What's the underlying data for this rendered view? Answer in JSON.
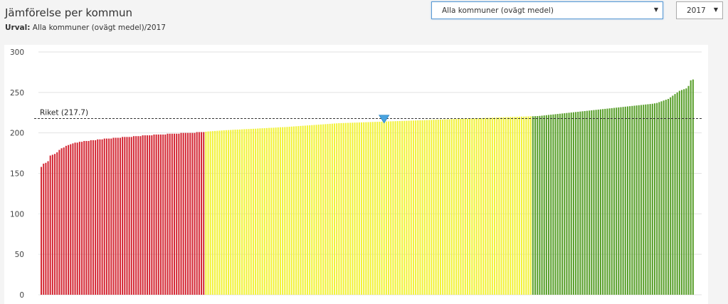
{
  "header": {
    "title": "Jämförelse per kommun",
    "subtitle_label": "Urval:",
    "subtitle_value": "Alla kommuner (ovägt medel)/2017"
  },
  "controls": {
    "municipality_select": "Alla kommuner (ovägt medel)",
    "year_select": "2017"
  },
  "colors": {
    "low": "#d42a36",
    "mid": "#f2f23a",
    "high": "#5aa02c",
    "marker": "#4aa3df",
    "grid": "#e2e2e2",
    "reference": "#333333"
  },
  "chart_data": {
    "type": "bar",
    "ylim": [
      0,
      300
    ],
    "yticks": [
      0,
      50,
      100,
      150,
      200,
      250,
      300
    ],
    "grid": true,
    "reference_line": {
      "label": "Riket (217.7)",
      "value": 217.7
    },
    "bar_count": 290,
    "segments": [
      {
        "color": "low",
        "count": 73
      },
      {
        "color": "mid",
        "count": 145
      },
      {
        "color": "high",
        "count": 72
      }
    ],
    "highlight_index": 152,
    "values": [
      158,
      162,
      163,
      165,
      172,
      173,
      174,
      176,
      179,
      181,
      182,
      184,
      185,
      186,
      187,
      188,
      188,
      189,
      189,
      190,
      190,
      190,
      191,
      191,
      191,
      192,
      192,
      192,
      193,
      193,
      193,
      193,
      194,
      194,
      194,
      194,
      195,
      195,
      195,
      195,
      195,
      196,
      196,
      196,
      196,
      197,
      197,
      197,
      197,
      197,
      198,
      198,
      198,
      198,
      198,
      198,
      199,
      199,
      199,
      199,
      199,
      199,
      200,
      200,
      200,
      200,
      200,
      200,
      200,
      201,
      201,
      201,
      201,
      201.5,
      201.8,
      202,
      202.2,
      202.4,
      202.6,
      202.8,
      203,
      203.2,
      203.4,
      203.5,
      203.6,
      203.8,
      204,
      204.1,
      204.2,
      204.4,
      204.6,
      204.7,
      204.8,
      205,
      205.1,
      205.2,
      205.4,
      205.6,
      205.7,
      205.8,
      206,
      206.2,
      206.3,
      206.4,
      206.6,
      206.8,
      207,
      207.1,
      207.2,
      207.4,
      207.6,
      207.8,
      208,
      208.2,
      208.4,
      208.6,
      208.8,
      209,
      209.2,
      209.4,
      209.6,
      209.8,
      210,
      210.2,
      210.4,
      210.6,
      210.8,
      211,
      211.2,
      211.4,
      211.6,
      211.8,
      212,
      212.1,
      212.2,
      212.3,
      212.4,
      212.5,
      212.6,
      212.7,
      212.8,
      212.9,
      213,
      213.1,
      213.2,
      213.3,
      213.4,
      213.5,
      213.6,
      213.7,
      213.8,
      213.9,
      214,
      214.1,
      214.2,
      214.3,
      214.4,
      214.5,
      214.6,
      214.7,
      214.8,
      214.9,
      215,
      215.1,
      215.2,
      215.3,
      215.4,
      215.5,
      215.6,
      215.7,
      215.8,
      215.9,
      216,
      216.1,
      216.2,
      216.3,
      216.4,
      216.5,
      216.6,
      216.7,
      216.8,
      216.9,
      217,
      217.1,
      217.2,
      217.3,
      217.4,
      217.5,
      217.6,
      217.7,
      217.8,
      217.9,
      218,
      218.1,
      218.2,
      218.3,
      218.4,
      218.5,
      218.6,
      218.7,
      218.8,
      218.9,
      219,
      219.1,
      219.2,
      219.3,
      219.4,
      219.5,
      219.6,
      219.7,
      219.8,
      219.9,
      220,
      220.1,
      220.2,
      220.3,
      220.4,
      220.5,
      220.6,
      220.7,
      220.8,
      221,
      221.3,
      221.6,
      221.9,
      222.2,
      222.5,
      222.8,
      223.1,
      223.4,
      223.7,
      224,
      224.3,
      224.6,
      224.9,
      225.2,
      225.5,
      225.8,
      226.1,
      226.4,
      226.7,
      227,
      227.3,
      227.6,
      227.9,
      228.2,
      228.5,
      228.8,
      229.1,
      229.4,
      229.7,
      230,
      230.3,
      230.6,
      230.9,
      231.2,
      231.5,
      231.8,
      232.1,
      232.4,
      232.7,
      233,
      233.3,
      233.6,
      233.9,
      234.2,
      234.5,
      234.8,
      235.1,
      235.4,
      235.7,
      236,
      236.5,
      237,
      238,
      239,
      240,
      241,
      242,
      244,
      246,
      248,
      250,
      252,
      253,
      254,
      255,
      258,
      265,
      266
    ]
  }
}
